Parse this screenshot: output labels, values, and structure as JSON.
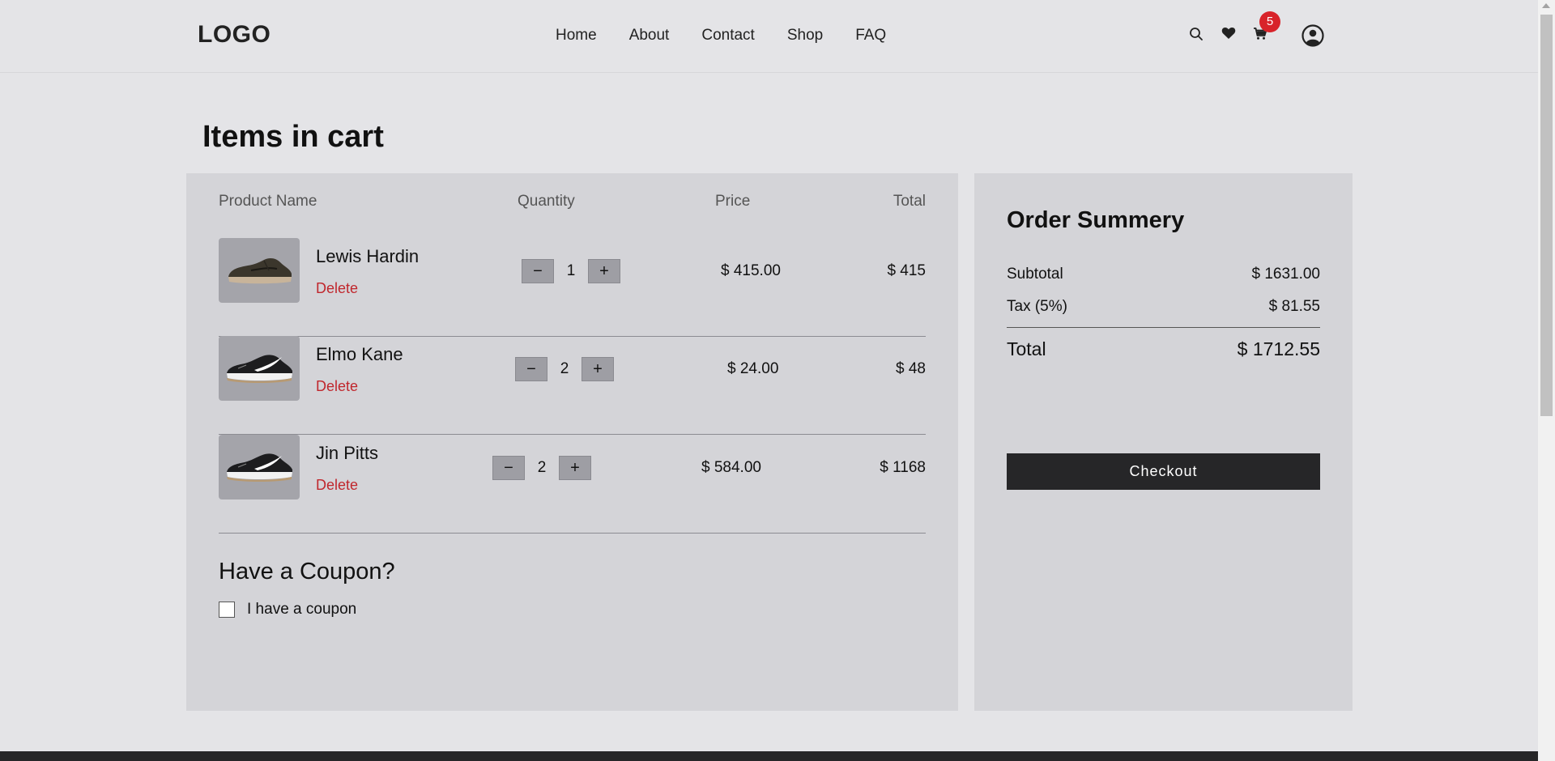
{
  "header": {
    "logo": "LOGO",
    "nav": [
      "Home",
      "About",
      "Contact",
      "Shop",
      "FAQ"
    ],
    "icons": [
      "search-icon",
      "heart-icon",
      "cart-icon",
      "user-icon"
    ],
    "cart_count": "5"
  },
  "page_title": "Items in cart",
  "cart": {
    "columns": {
      "product": "Product Name",
      "quantity": "Quantity",
      "price": "Price",
      "total": "Total"
    },
    "delete_label": "Delete",
    "minus_label": "−",
    "plus_label": "+",
    "items": [
      {
        "name": "Lewis Hardin",
        "qty": "1",
        "price": "$ 415.00",
        "total": "$ 415"
      },
      {
        "name": "Elmo Kane",
        "qty": "2",
        "price": "$ 24.00",
        "total": "$ 48"
      },
      {
        "name": "Jin Pitts",
        "qty": "2",
        "price": "$ 584.00",
        "total": "$ 1168"
      }
    ]
  },
  "coupon": {
    "title": "Have a Coupon?",
    "checkbox_label": "I have a coupon",
    "checked": false
  },
  "summary": {
    "title": "Order Summery",
    "subtotal_label": "Subtotal",
    "subtotal_value": "$ 1631.00",
    "tax_label": "Tax (5%)",
    "tax_value": "$ 81.55",
    "total_label": "Total",
    "total_value": "$ 1712.55",
    "checkout_label": "Checkout"
  },
  "colors": {
    "page_bg": "#e4e4e7",
    "panel_bg": "#d4d4d8",
    "delete": "#c0272d",
    "badge": "#d8232a",
    "button_dark": "#262628"
  }
}
